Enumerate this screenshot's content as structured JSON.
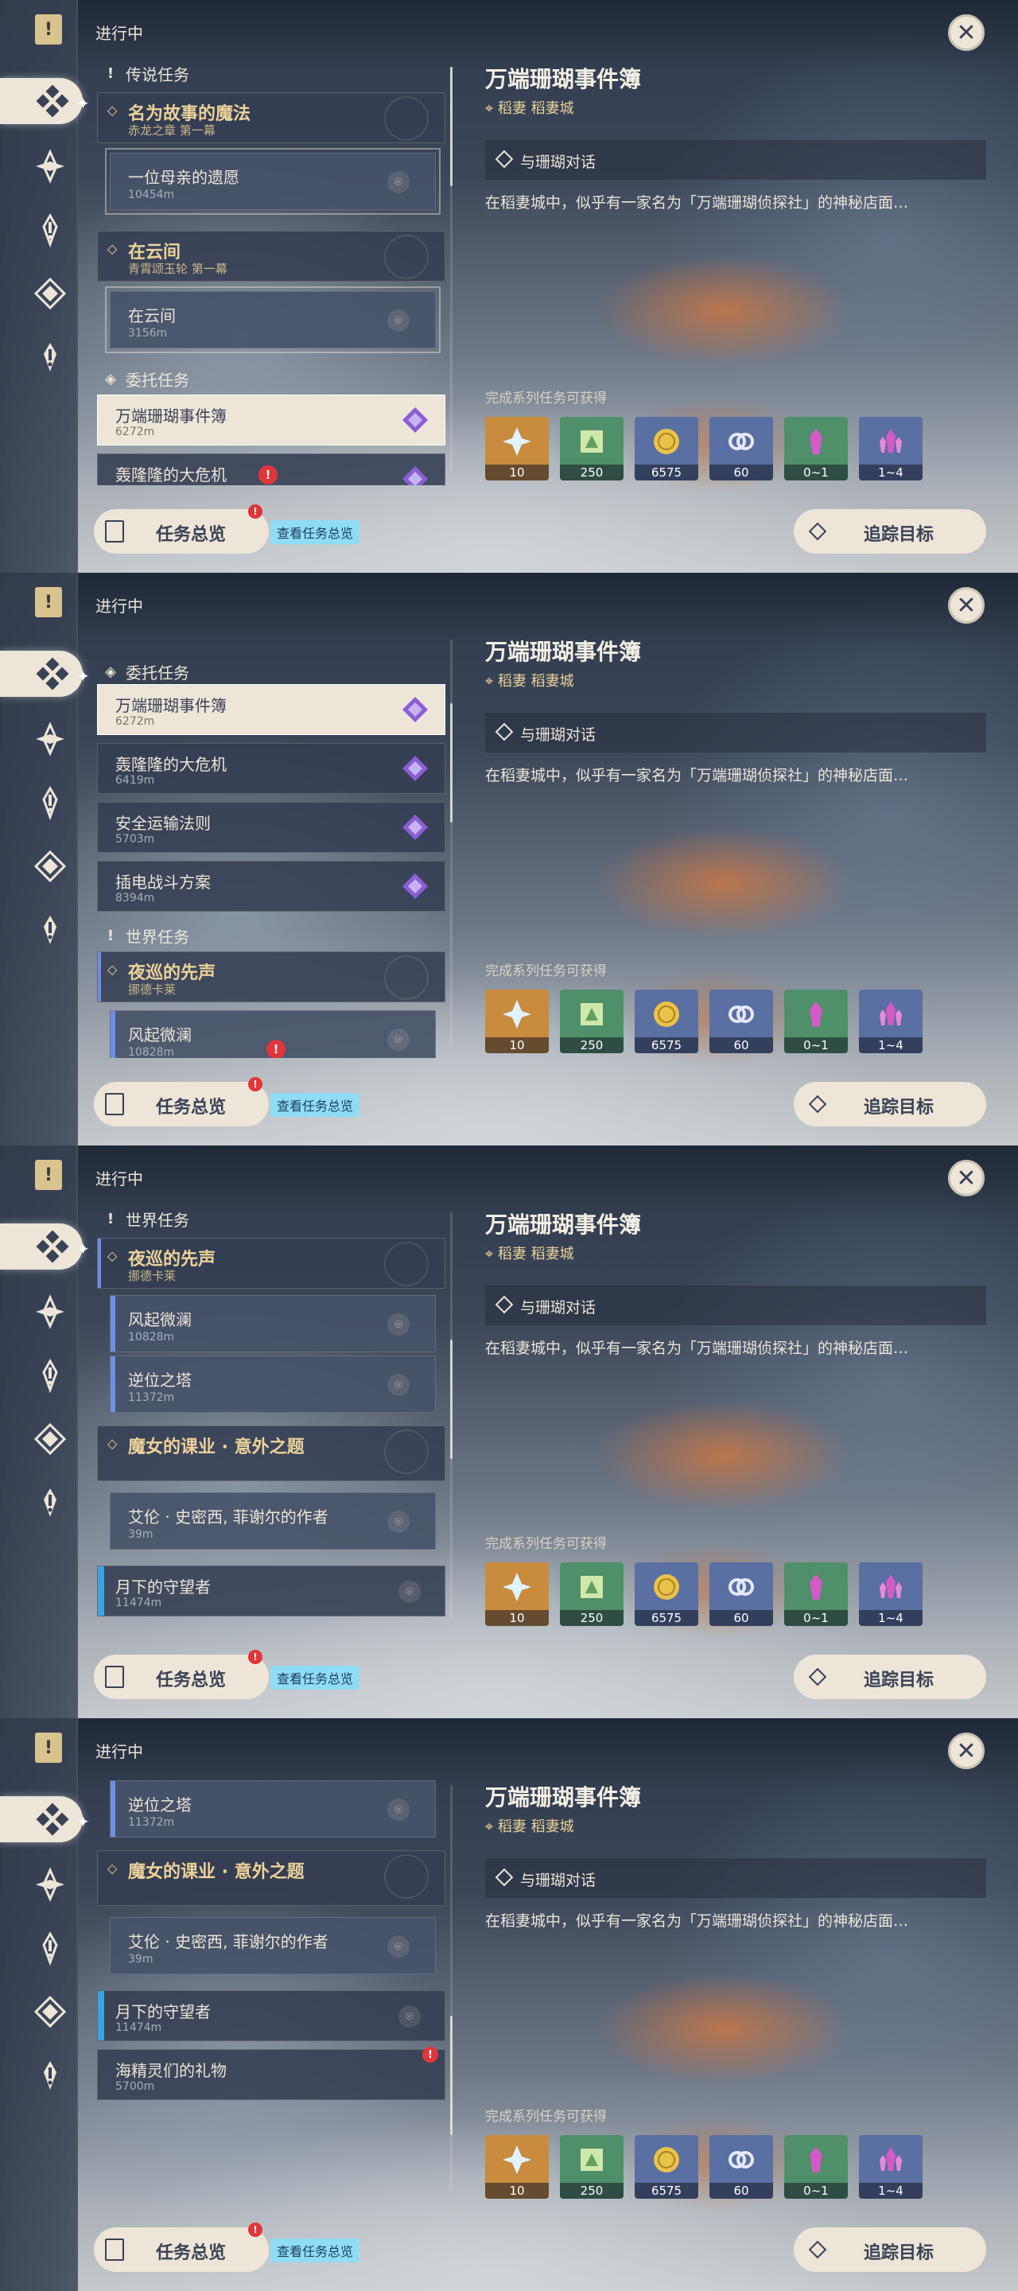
{
  "header": {
    "title": "进行中"
  },
  "overview": {
    "label": "任务总览",
    "tip": "查看任务总览",
    "badge": "!"
  },
  "detail": {
    "title": "万端珊瑚事件簿",
    "location": "稻妻 稻妻城",
    "objective": "与珊瑚对话",
    "description": "在稻妻城中，似乎有一家名为「万端珊瑚侦探社」的神秘店面…",
    "reward_label": "完成系列任务可获得",
    "rewards": [
      {
        "name": "primogem-icon",
        "count": "10",
        "color": "#c98b3e"
      },
      {
        "name": "adventure-exp-icon",
        "count": "250",
        "color": "#4f8f6a"
      },
      {
        "name": "mora-icon",
        "count": "6575",
        "color": "#5a6fa2"
      },
      {
        "name": "companionship-exp-icon",
        "count": "60",
        "color": "#5a6fa2"
      },
      {
        "name": "crystal-purple-icon",
        "count": "0~1",
        "color": "#4f8f6a"
      },
      {
        "name": "crystal-cluster-icon",
        "count": "1~4",
        "color": "#5a6fa2"
      }
    ],
    "track_label": "追踪目标"
  },
  "panels": [
    {
      "sections": [
        {
          "label": "传说任务",
          "icon": "!"
        },
        {
          "label": "委托任务",
          "icon": "◈"
        }
      ],
      "groups": [
        {
          "title": "名为故事的魔法",
          "sub": "赤龙之章 第一幕"
        },
        {
          "title": "在云间",
          "sub": "青霄颂玉轮 第一幕"
        }
      ],
      "subs": [
        {
          "title": "一位母亲的遗愿",
          "dist": "10454m"
        },
        {
          "title": "在云间",
          "dist": "3156m"
        }
      ],
      "items": [
        {
          "title": "万端珊瑚事件簿",
          "dist": "6272m"
        },
        {
          "title": "轰隆隆的大危机",
          "dist": ""
        }
      ]
    },
    {
      "sections": [
        {
          "label": "委托任务",
          "icon": "◈"
        },
        {
          "label": "世界任务",
          "icon": "!"
        }
      ],
      "groups": [
        {
          "title": "夜巡的先声",
          "sub": "挪德卡莱"
        }
      ],
      "subs": [
        {
          "title": "风起微澜",
          "dist": "10828m"
        }
      ],
      "items": [
        {
          "title": "万端珊瑚事件簿",
          "dist": "6272m"
        },
        {
          "title": "轰隆隆的大危机",
          "dist": "6419m"
        },
        {
          "title": "安全运输法则",
          "dist": "5703m"
        },
        {
          "title": "插电战斗方案",
          "dist": "8394m"
        }
      ]
    },
    {
      "sections": [
        {
          "label": "世界任务",
          "icon": "!"
        }
      ],
      "groups": [
        {
          "title": "夜巡的先声",
          "sub": "挪德卡莱"
        },
        {
          "title": "魔女的课业 · 意外之题",
          "sub": ""
        }
      ],
      "subs": [
        {
          "title": "风起微澜",
          "dist": "10828m"
        },
        {
          "title": "逆位之塔",
          "dist": "11372m"
        },
        {
          "title": "艾伦 · 史密西, 菲谢尔的作者",
          "dist": "39m"
        }
      ],
      "items": [
        {
          "title": "月下的守望者",
          "dist": "11474m"
        }
      ]
    },
    {
      "sections": [],
      "groups": [
        {
          "title": "魔女的课业 · 意外之题",
          "sub": ""
        }
      ],
      "subs": [
        {
          "title": "逆位之塔",
          "dist": "11372m"
        },
        {
          "title": "艾伦 · 史密西, 菲谢尔的作者",
          "dist": "39m"
        }
      ],
      "items": [
        {
          "title": "月下的守望者",
          "dist": "11474m"
        },
        {
          "title": "海精灵们的礼物",
          "dist": "5700m"
        }
      ]
    }
  ]
}
